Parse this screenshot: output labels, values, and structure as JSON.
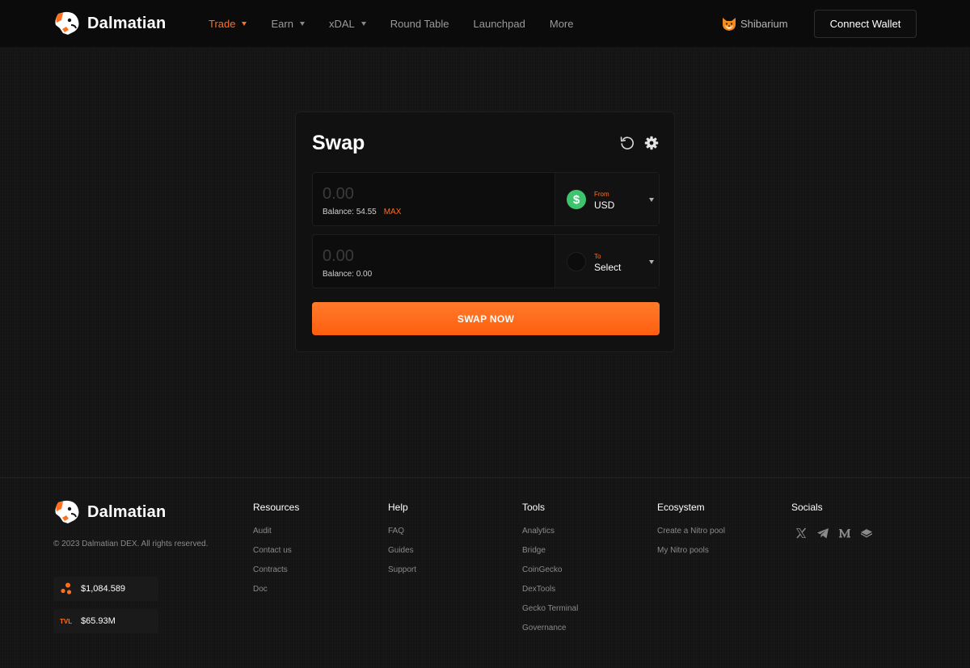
{
  "brand": {
    "name": "Dalmatian"
  },
  "nav": {
    "items": [
      {
        "label": "Trade",
        "dropdown": true,
        "active": true
      },
      {
        "label": "Earn",
        "dropdown": true,
        "active": false
      },
      {
        "label": "xDAL",
        "dropdown": true,
        "active": false
      },
      {
        "label": "Round Table",
        "dropdown": false,
        "active": false
      },
      {
        "label": "Launchpad",
        "dropdown": false,
        "active": false
      },
      {
        "label": "More",
        "dropdown": false,
        "active": false
      }
    ]
  },
  "network": {
    "label": "Shibarium",
    "icon": "shiba-inu-icon"
  },
  "connect": {
    "label": "Connect Wallet"
  },
  "swap": {
    "title": "Swap",
    "icons": [
      "refresh-icon",
      "gear-icon"
    ],
    "from": {
      "amount_placeholder": "0.00",
      "balance": "Balance: 54.55",
      "max_label": "MAX",
      "selector_label": "From",
      "token": "USD",
      "token_icon_glyph": "$"
    },
    "to": {
      "amount_placeholder": "0.00",
      "balance": "Balance: 0.00",
      "selector_label": "To",
      "token": "Select"
    },
    "button_label": "SWAP NOW"
  },
  "footer": {
    "copyright": "© 2023 Dalmatian DEX. All rights reserved.",
    "price": "$1,084.589",
    "tvl_label": "TVL",
    "tvl_value": "$65.93M",
    "columns": {
      "resources": {
        "title": "Resources",
        "links": [
          "Audit",
          "Contact us",
          "Contracts",
          "Doc"
        ]
      },
      "help": {
        "title": "Help",
        "links": [
          "FAQ",
          "Guides",
          "Support"
        ]
      },
      "tools": {
        "title": "Tools",
        "links": [
          "Analytics",
          "Bridge",
          "CoinGecko",
          "DexTools",
          "Gecko Terminal",
          "Governance"
        ]
      },
      "ecosystem": {
        "title": "Ecosystem",
        "links": [
          "Create a Nitro pool",
          "My Nitro pools"
        ]
      },
      "socials": {
        "title": "Socials",
        "icons": [
          "x-icon",
          "telegram-icon",
          "medium-icon",
          "gitbook-icon"
        ]
      }
    }
  },
  "colors": {
    "accent": "#ff6f1f",
    "background": "#151515",
    "header": "#0b0b0b",
    "usd_token": "#3ec46d"
  }
}
